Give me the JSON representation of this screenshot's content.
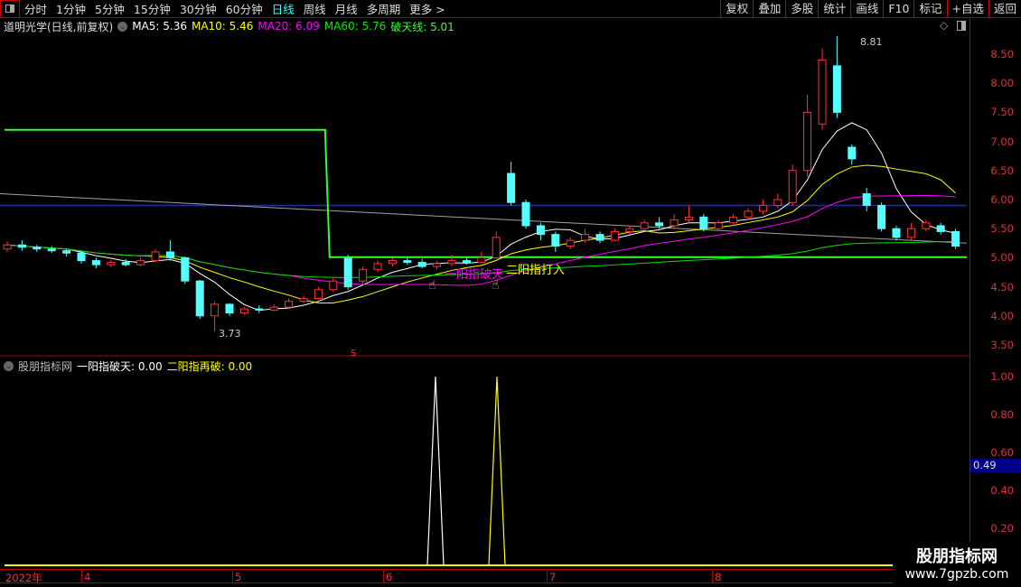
{
  "toolbar": {
    "periods": [
      "分时",
      "1分钟",
      "5分钟",
      "15分钟",
      "30分钟",
      "60分钟",
      "日线",
      "周线",
      "月线",
      "多周期",
      "更多 >"
    ],
    "active": "日线",
    "right": [
      "复权",
      "叠加",
      "多股",
      "统计",
      "画线",
      "F10",
      "标记",
      "+自选",
      "返回"
    ]
  },
  "main_legend": {
    "title": "道明光学(日线,前复权)",
    "ma5": "MA5: 5.36",
    "ma10": "MA10: 5.46",
    "ma20": "MA20: 6.09",
    "ma60": "MA60: 5.76",
    "potian": "破天线: 5.01"
  },
  "sub_legend": {
    "title": "股朋指标网",
    "s1": "一阳指破天: 0.00",
    "s2": "二阳指再破: 0.00"
  },
  "colors": {
    "up": "#ff3333",
    "down": "#54ffff",
    "ma5": "#ffffff",
    "ma10": "#ffff00",
    "ma20": "#ff00ff",
    "ma60": "#00e000",
    "potian": "#33ff33",
    "blue": "#2020ff",
    "gray": "#a0a0a0"
  },
  "annotations": {
    "high": "8.81",
    "low": "3.73",
    "signal1": "一阳指破天",
    "signal2": "二阳指打入",
    "marker": "S"
  },
  "chart_data": {
    "type": "candlestick",
    "price_ticks": [
      "8.50",
      "8.00",
      "7.50",
      "7.00",
      "6.50",
      "6.00",
      "5.50",
      "5.00",
      "4.50",
      "4.00",
      "3.50"
    ],
    "ylim": [
      3.5,
      8.5
    ],
    "candles": [
      [
        5.15,
        5.22,
        5.28,
        5.1
      ],
      [
        5.22,
        5.18,
        5.3,
        5.12
      ],
      [
        5.18,
        5.15,
        5.22,
        5.1
      ],
      [
        5.15,
        5.12,
        5.2,
        5.08
      ],
      [
        5.12,
        5.08,
        5.15,
        5.02
      ],
      [
        5.08,
        4.95,
        5.12,
        4.9
      ],
      [
        4.95,
        4.88,
        5.0,
        4.82
      ],
      [
        4.88,
        4.92,
        4.96,
        4.84
      ],
      [
        4.92,
        4.88,
        4.98,
        4.85
      ],
      [
        4.88,
        4.95,
        5.0,
        4.85
      ],
      [
        4.95,
        5.1,
        5.15,
        4.92
      ],
      [
        5.1,
        5.0,
        5.3,
        4.95
      ],
      [
        5.0,
        4.6,
        5.02,
        4.55
      ],
      [
        4.6,
        4.0,
        4.62,
        3.95
      ],
      [
        4.0,
        4.2,
        4.25,
        3.73
      ],
      [
        4.2,
        4.05,
        4.22,
        4.0
      ],
      [
        4.05,
        4.12,
        4.15,
        4.02
      ],
      [
        4.12,
        4.1,
        4.18,
        4.05
      ],
      [
        4.1,
        4.15,
        4.2,
        4.08
      ],
      [
        4.15,
        4.25,
        4.3,
        4.12
      ],
      [
        4.25,
        4.3,
        4.35,
        4.22
      ],
      [
        4.3,
        4.45,
        4.5,
        4.28
      ],
      [
        4.45,
        4.6,
        4.65,
        4.42
      ],
      [
        5.0,
        4.5,
        5.05,
        4.45
      ],
      [
        4.6,
        4.8,
        4.85,
        4.55
      ],
      [
        4.8,
        4.9,
        4.95,
        4.75
      ],
      [
        4.9,
        4.95,
        5.0,
        4.85
      ],
      [
        4.95,
        4.92,
        5.0,
        4.88
      ],
      [
        4.92,
        4.85,
        4.98,
        4.82
      ],
      [
        4.85,
        4.9,
        4.95,
        4.8
      ],
      [
        4.9,
        4.95,
        5.05,
        4.85
      ],
      [
        4.95,
        4.92,
        5.0,
        4.88
      ],
      [
        4.92,
        5.0,
        5.1,
        4.9
      ],
      [
        5.0,
        5.35,
        5.45,
        4.98
      ],
      [
        6.45,
        5.95,
        6.65,
        5.9
      ],
      [
        5.95,
        5.55,
        6.0,
        5.5
      ],
      [
        5.55,
        5.4,
        5.6,
        5.3
      ],
      [
        5.4,
        5.2,
        5.45,
        5.1
      ],
      [
        5.2,
        5.3,
        5.35,
        5.15
      ],
      [
        5.3,
        5.4,
        5.5,
        5.25
      ],
      [
        5.4,
        5.3,
        5.45,
        5.25
      ],
      [
        5.3,
        5.45,
        5.5,
        5.28
      ],
      [
        5.45,
        5.5,
        5.55,
        5.4
      ],
      [
        5.5,
        5.6,
        5.65,
        5.45
      ],
      [
        5.6,
        5.55,
        5.7,
        5.5
      ],
      [
        5.55,
        5.65,
        5.75,
        5.5
      ],
      [
        5.65,
        5.7,
        5.9,
        5.6
      ],
      [
        5.7,
        5.5,
        5.75,
        5.45
      ],
      [
        5.5,
        5.6,
        5.65,
        5.48
      ],
      [
        5.6,
        5.7,
        5.75,
        5.55
      ],
      [
        5.7,
        5.8,
        5.85,
        5.65
      ],
      [
        5.8,
        5.9,
        6.0,
        5.75
      ],
      [
        5.9,
        6.0,
        6.1,
        5.85
      ],
      [
        5.95,
        6.5,
        6.6,
        5.9
      ],
      [
        6.5,
        7.5,
        7.8,
        6.4
      ],
      [
        7.3,
        8.4,
        8.6,
        7.2
      ],
      [
        8.3,
        7.5,
        8.81,
        7.4
      ],
      [
        6.9,
        6.7,
        6.95,
        6.6
      ],
      [
        6.1,
        5.9,
        6.2,
        5.8
      ],
      [
        5.9,
        5.5,
        5.95,
        5.45
      ],
      [
        5.5,
        5.35,
        5.55,
        5.3
      ],
      [
        5.35,
        5.5,
        5.6,
        5.3
      ],
      [
        5.5,
        5.6,
        5.65,
        5.45
      ],
      [
        5.55,
        5.45,
        5.6,
        5.4
      ],
      [
        5.45,
        5.2,
        5.5,
        5.15
      ]
    ],
    "potian_line": {
      "before": 7.2,
      "after": 5.01,
      "switch_index": 22
    },
    "blue_line": 5.9,
    "gray_line": [
      6.1,
      5.25
    ],
    "signal_indices": [
      28,
      32
    ],
    "sub_ticks": [
      "1.00",
      "0.80",
      "0.60",
      "0.40",
      "0.20"
    ],
    "sub_ylim": [
      0,
      1
    ],
    "current_value": "0.49",
    "time_labels": [
      "2022年",
      "4",
      "5",
      "6",
      "7",
      "8"
    ]
  }
}
